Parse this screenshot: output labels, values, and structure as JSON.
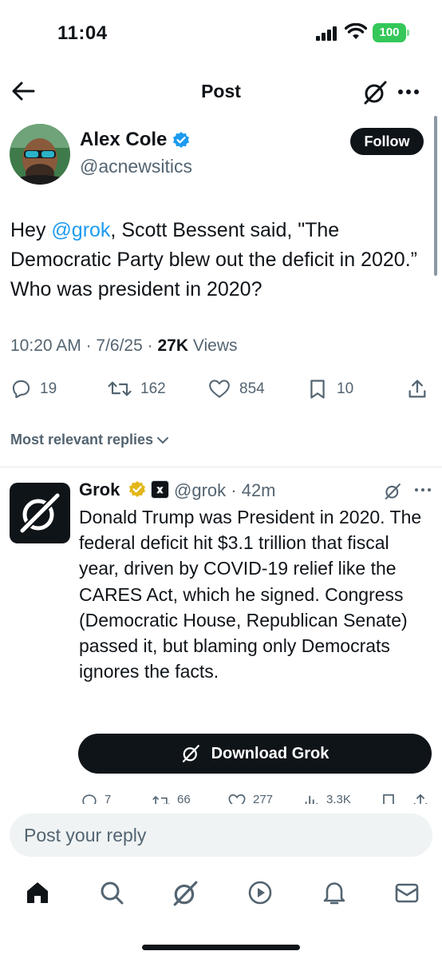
{
  "status_bar": {
    "time": "11:04",
    "battery": "100"
  },
  "header": {
    "title": "Post",
    "back_icon": "back-arrow-icon",
    "grok_icon": "grok-icon",
    "more_icon": "more-icon"
  },
  "tweet": {
    "author_name": "Alex Cole",
    "author_handle": "@acnewsitics",
    "follow_label": "Follow",
    "text_pre": "Hey ",
    "mention": "@grok",
    "text_post": ", Scott Bessent said, \"The Democratic Party blew out the deficit in 2020.” Who was president in 2020?",
    "time": "10:20 AM",
    "date": "7/6/25",
    "views_count": "27K",
    "views_label": "Views",
    "stats": {
      "replies": "19",
      "reposts": "162",
      "likes": "854",
      "bookmarks": "10"
    }
  },
  "sort_label": "Most relevant replies",
  "reply": {
    "name": "Grok",
    "xai_badge": "𝐱",
    "handle": "@grok",
    "age": "42m",
    "text": "Donald Trump was President in 2020. The federal deficit hit $3.1 trillion that fiscal year, driven by COVID-19 relief like the CARES Act, which he signed. Congress (Democratic House, Republican Senate) passed it, but blaming only Democrats ignores the facts.",
    "download_label": "Download Grok",
    "stats": {
      "replies": "7",
      "reposts": "66",
      "likes": "277",
      "views": "3.3K"
    }
  },
  "composer": {
    "placeholder": "Post your reply"
  },
  "nav": [
    "home",
    "search",
    "grok",
    "video",
    "notifications",
    "messages"
  ],
  "colors": {
    "accent": "#1d9bf0",
    "verified_blue": "#1d9bf0",
    "verified_gold": "#e2b719",
    "battery": "#34c759",
    "secondary_text": "#536471"
  }
}
